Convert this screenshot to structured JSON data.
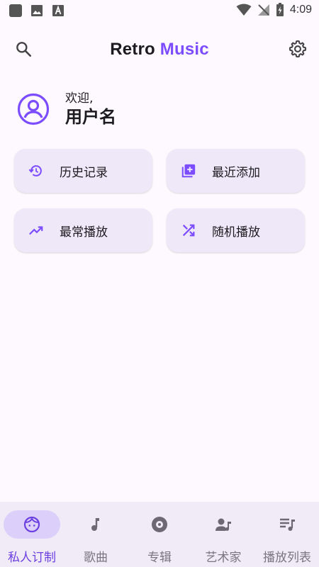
{
  "status_bar": {
    "time": "4:09"
  },
  "app_bar": {
    "title_part1": "Retro",
    "title_part2": "Music"
  },
  "user": {
    "greeting": "欢迎,",
    "name": "用户名"
  },
  "cards": [
    {
      "label": "历史记录",
      "icon": "history-icon"
    },
    {
      "label": "最近添加",
      "icon": "library-add-icon"
    },
    {
      "label": "最常播放",
      "icon": "trending-up-icon"
    },
    {
      "label": "随机播放",
      "icon": "shuffle-icon"
    }
  ],
  "bottom_nav": [
    {
      "label": "私人订制",
      "icon": "face-icon",
      "active": true
    },
    {
      "label": "歌曲",
      "icon": "music-note-icon",
      "active": false
    },
    {
      "label": "专辑",
      "icon": "album-icon",
      "active": false
    },
    {
      "label": "艺术家",
      "icon": "artist-icon",
      "active": false
    },
    {
      "label": "播放列表",
      "icon": "playlist-icon",
      "active": false
    }
  ],
  "colors": {
    "accent": "#7c4dff",
    "card_bg": "#efe8f9",
    "nav_bg": "#f1ebf7"
  }
}
